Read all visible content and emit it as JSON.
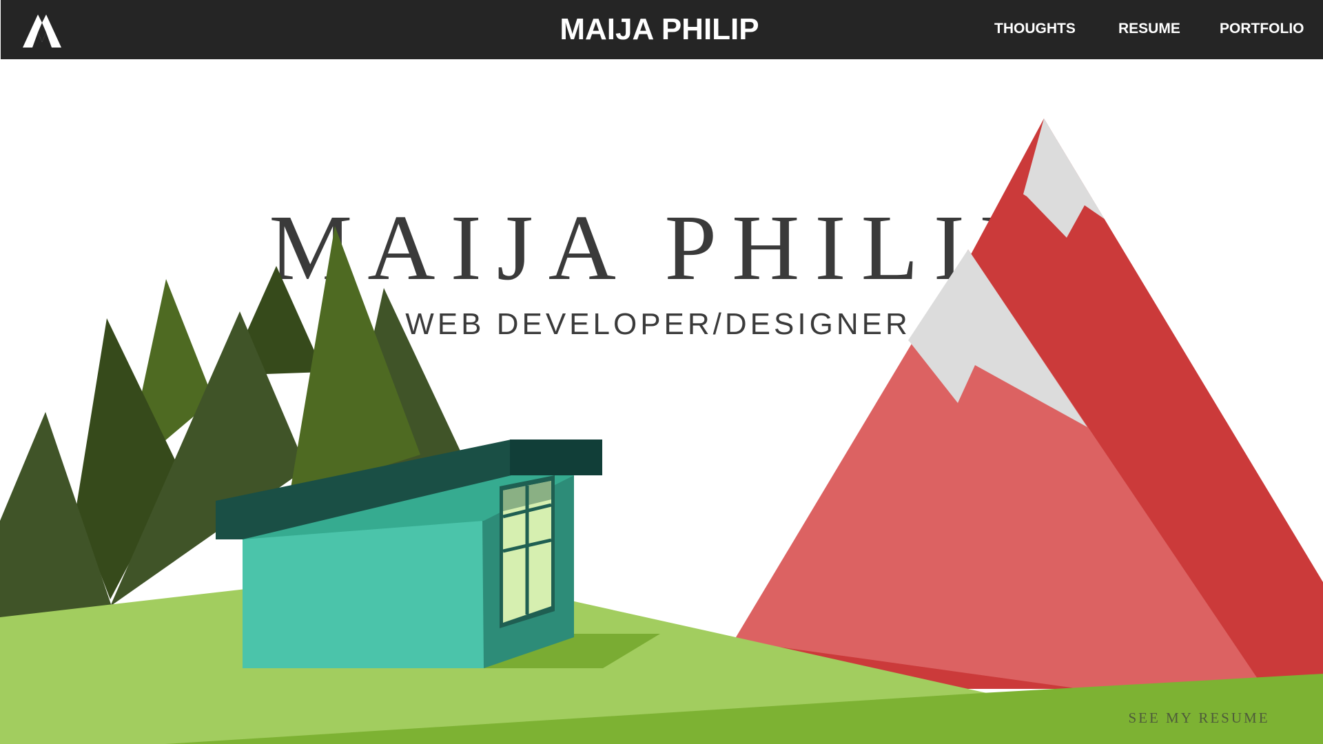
{
  "header": {
    "logo_icon": "mountain-monogram-icon",
    "brand": "MAIJA PHILIP",
    "nav": [
      {
        "label": "THOUGHTS"
      },
      {
        "label": "RESUME"
      },
      {
        "label": "PORTFOLIO"
      }
    ]
  },
  "hero": {
    "title": "MAIJA PHILIP",
    "subtitle": "WEB DEVELOPER/DESIGNER",
    "cta_label": "SEE MY RESUME"
  },
  "colors": {
    "topbar": "#252525",
    "text_dark": "#3a3a3a",
    "grass_light": "#a2cd5f",
    "grass_dark": "#7db233",
    "mountain_light": "#dc6262",
    "mountain_dark": "#cb3a3a",
    "snow": "#dcdcdc",
    "tree_dark": "#364a1b",
    "tree_mid": "#405428",
    "tree_light": "#4e6a22",
    "cabin_front": "#4bc4aa",
    "cabin_side": "#2d8c78",
    "cabin_roof": "#1a4f45",
    "window": "#d6efb0"
  }
}
